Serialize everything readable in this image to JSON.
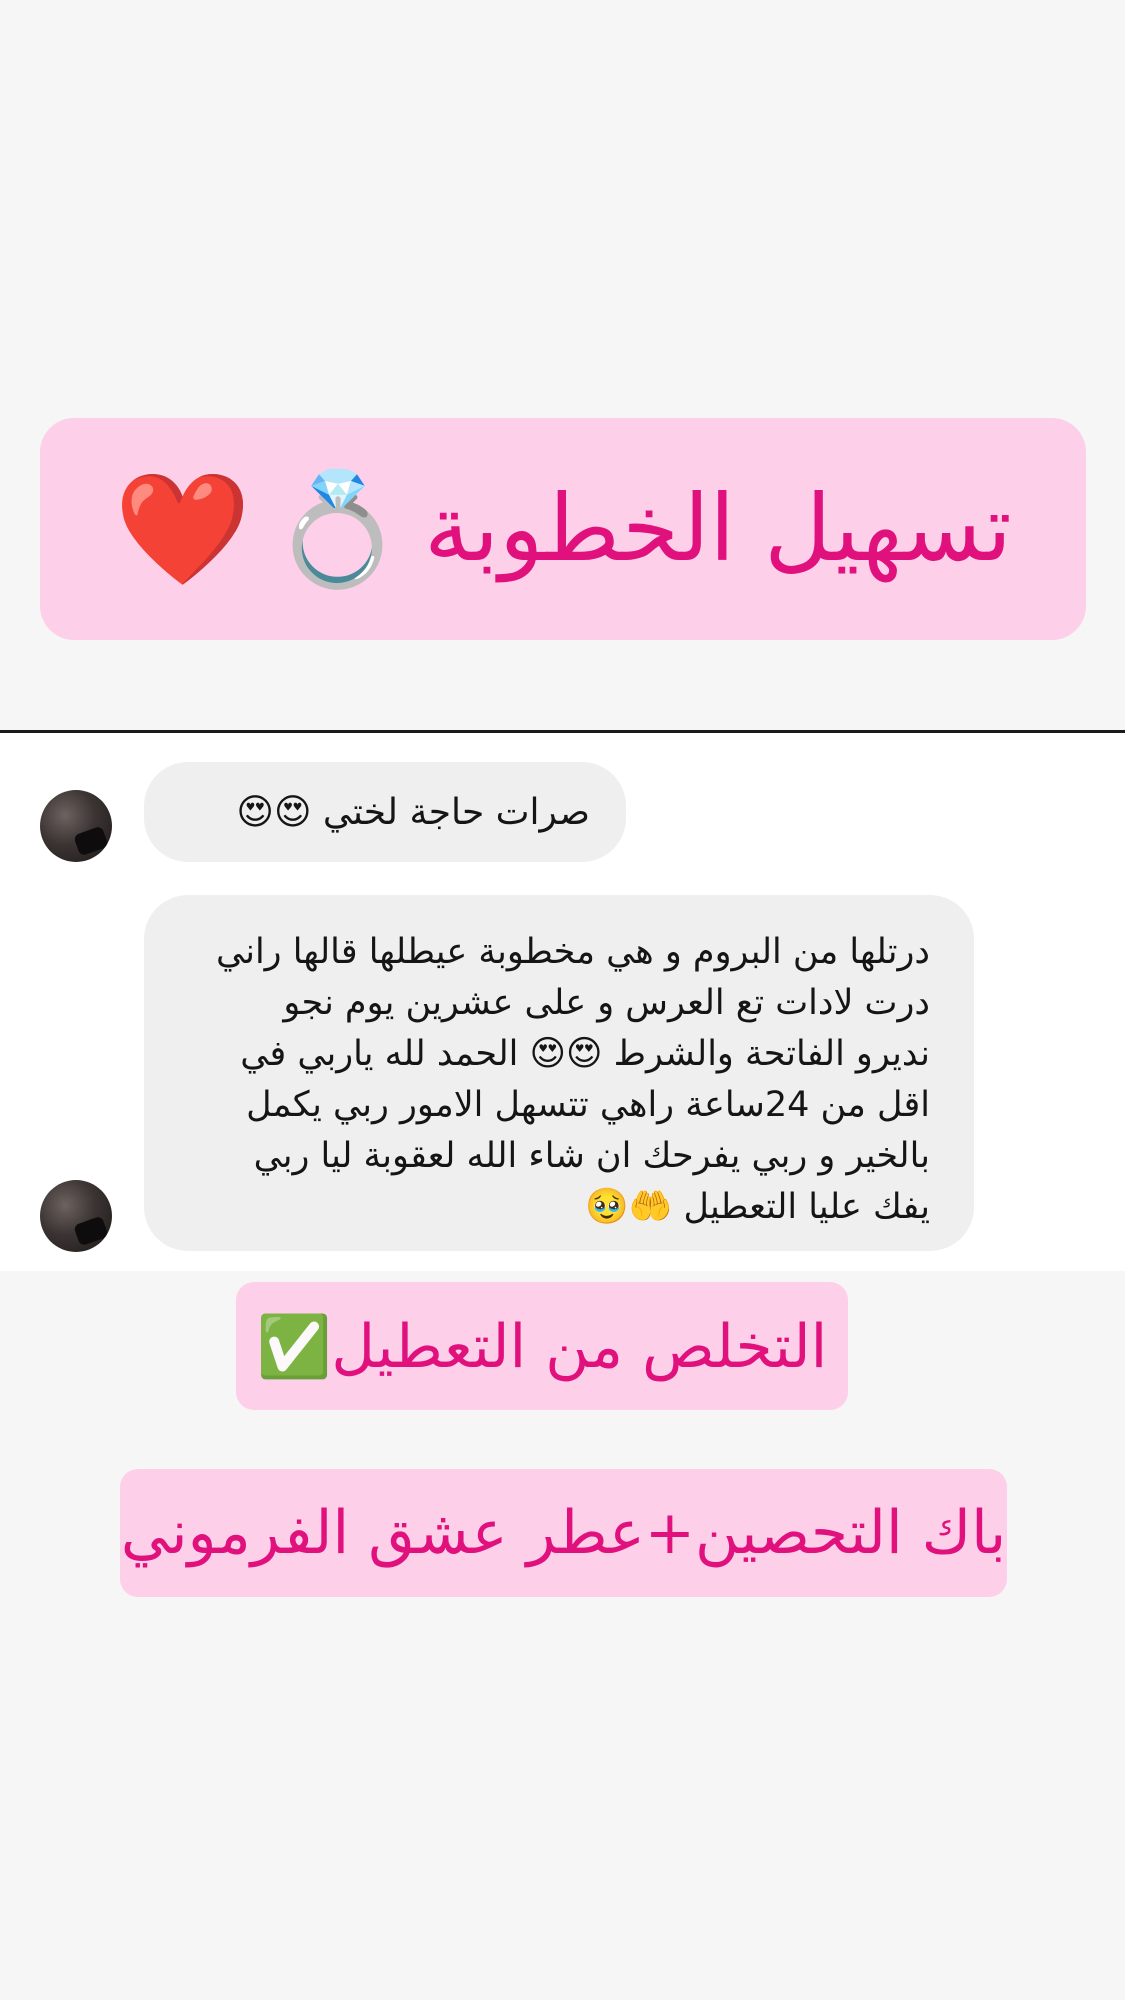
{
  "headline": {
    "text": "تسهيل الخطوبة",
    "emoji_ring": "💍",
    "emoji_heart": "❤️"
  },
  "chat": {
    "messages": [
      {
        "text": "صرات حاجة لختي 😍😍"
      },
      {
        "lines": [
          "درتلها من البروم و هي مخطوبة عيطلها قالها راني",
          "درت لادات تع العرس و على عشرين يوم نجو",
          "نديرو الفاتحة والشرط 😍😍 الحمد لله ياربي في",
          "اقل من 24ساعة راهي تتسهل الامور ربي يكمل",
          "بالخير و ربي يفرحك ان شاء الله لعقوبة ليا ربي",
          "يفك عليا التعطيل 🤲🥹"
        ]
      }
    ]
  },
  "pills": [
    "التخلص من التعطيل✅",
    "باك التحصين+عطر عشق الفرموني"
  ],
  "colors": {
    "accent_pink_text": "#e0117d",
    "pill_background": "#fdcfe9",
    "bubble_background": "#efefef"
  }
}
